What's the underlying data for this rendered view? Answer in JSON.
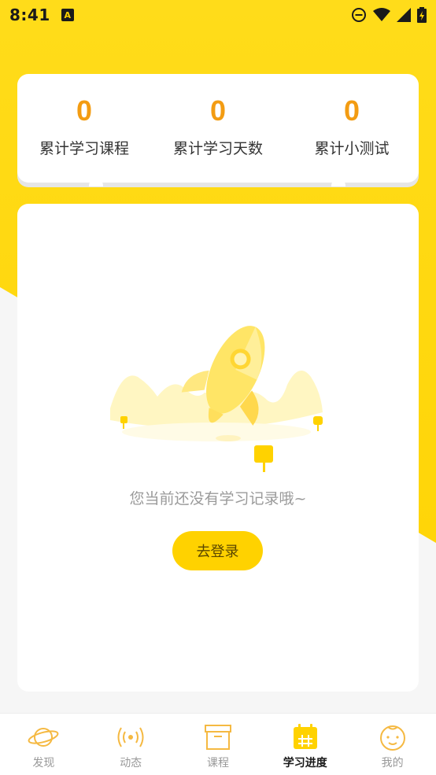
{
  "status_bar": {
    "time": "8:41",
    "notification_icon": "A"
  },
  "stats": [
    {
      "value": "0",
      "label": "累计学习课程"
    },
    {
      "value": "0",
      "label": "累计学习天数"
    },
    {
      "value": "0",
      "label": "累计小测试"
    }
  ],
  "empty_state": {
    "message": "您当前还没有学习记录哦~",
    "login_button": "去登录"
  },
  "tabs": [
    {
      "label": "发现",
      "icon": "planet-icon",
      "active": false
    },
    {
      "label": "动态",
      "icon": "broadcast-icon",
      "active": false
    },
    {
      "label": "课程",
      "icon": "archive-box-icon",
      "active": false
    },
    {
      "label": "学习进度",
      "icon": "calendar-icon",
      "active": true
    },
    {
      "label": "我的",
      "icon": "face-icon",
      "active": false
    }
  ],
  "colors": {
    "brand_yellow": "#ffd200",
    "stat_orange": "#f39c12",
    "inactive_tab": "#f5b942"
  }
}
